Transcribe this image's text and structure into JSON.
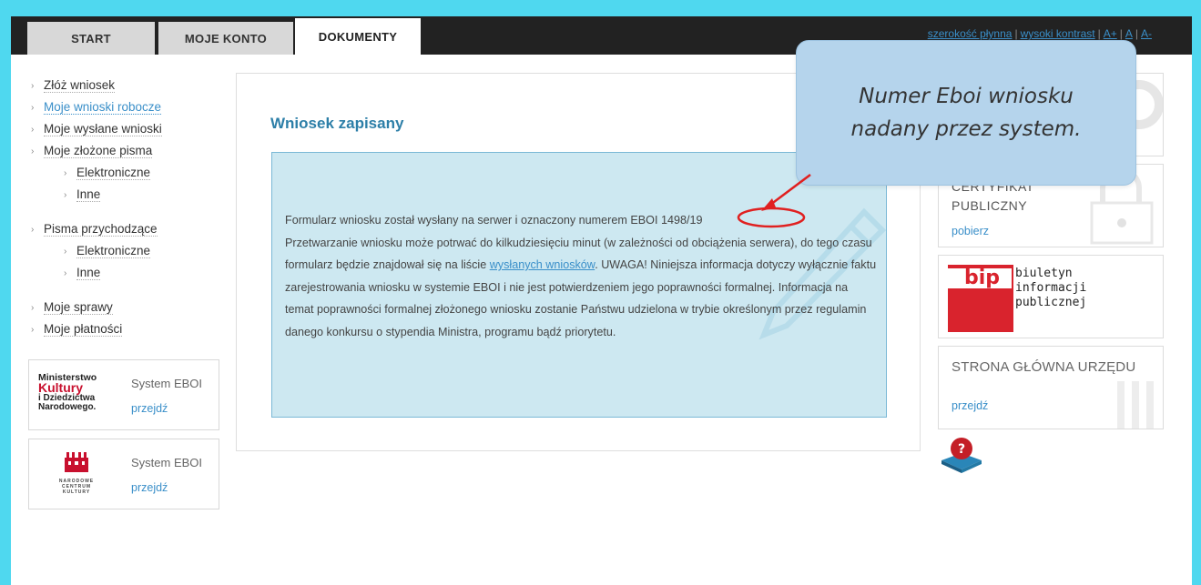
{
  "topnav": {
    "tabs": [
      {
        "label": "START"
      },
      {
        "label": "MOJE KONTO"
      },
      {
        "label": "DOKUMENTY"
      }
    ],
    "links": {
      "fluid_width": "szerokość płynna",
      "high_contrast": "wysoki kontrast",
      "font_larger": "A+",
      "font_normal": "A",
      "font_smaller": "A-",
      "separator": "|"
    }
  },
  "sidebar": {
    "items": [
      {
        "label": "Złóż wniosek"
      },
      {
        "label": "Moje wnioski robocze"
      },
      {
        "label": "Moje wysłane wnioski"
      },
      {
        "label": "Moje złożone pisma"
      },
      {
        "label": "Elektroniczne"
      },
      {
        "label": "Inne"
      },
      {
        "label": "Pisma przychodzące"
      },
      {
        "label": "Elektroniczne"
      },
      {
        "label": "Inne"
      },
      {
        "label": "Moje sprawy"
      },
      {
        "label": "Moje płatności"
      }
    ],
    "ext_systems": [
      {
        "logo_lines": [
          "Ministerstwo",
          "Kultury",
          "i Dziedzictwa",
          "Narodowego."
        ],
        "title": "System EBOI",
        "link": "przejdź"
      },
      {
        "logo_lines": [
          "NARODOWE",
          "CENTRUM",
          "KULTURY"
        ],
        "title": "System EBOI",
        "link": "przejdź"
      }
    ]
  },
  "main": {
    "title": "Wniosek zapisany",
    "message": {
      "part1": "Formularz wniosku został wysłany na serwer i oznaczony numerem EBOI ",
      "number": "1498/19",
      "part2": "Przetwarzanie wniosku może potrwać do kilkudziesięciu minut (w zależności od obciążenia serwera), do tego czasu formularz będzie znajdował się na liście ",
      "link": "wysłanych wniosków",
      "part3": ". UWAGA! Niniejsza informacja dotyczy wyłącznie faktu zarejestrowania wniosku w systemie EBOI i nie jest potwierdzeniem jego poprawności formalnej. Informacja na temat poprawności formalnej złożonego wniosku zostanie Państwu udzielona w trybie określonym przez regulamin danego konkursu o stypendia Ministra, programu bądź priorytetu."
    }
  },
  "annotation": {
    "line1": "Numer Eboi wniosku",
    "line2": "nadany przez system."
  },
  "right": {
    "cert": {
      "title_line1": "CERTYFIKAT",
      "title_line2": "PUBLICZNY",
      "link": "pobierz"
    },
    "bip": {
      "logo": "bip",
      "line1": "biuletyn",
      "line2": "informacji publicznej"
    },
    "strona": {
      "title": "STRONA GŁÓWNA URZĘDU",
      "link": "przejdź"
    },
    "help_icon": "help-book-icon"
  },
  "colors": {
    "frame": "#4fd8ef",
    "topbar": "#222222",
    "accent_link": "#3a8fc9",
    "title": "#2d7fa8",
    "message_bg": "#cde8f1",
    "annotation": "#e02020",
    "callout_bg": "#b5d4ec",
    "bip_red": "#d9232d"
  }
}
